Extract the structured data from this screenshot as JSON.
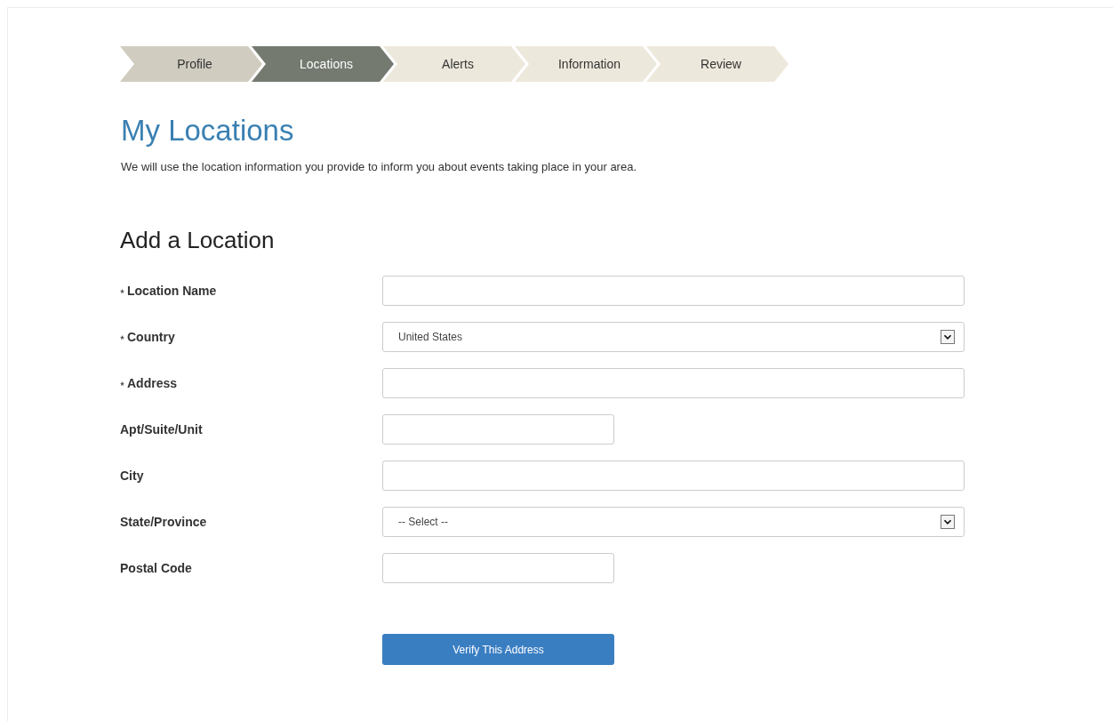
{
  "steps": [
    {
      "label": "Profile",
      "completed": true,
      "selected": false
    },
    {
      "label": "Locations",
      "completed": false,
      "selected": true
    },
    {
      "label": "Alerts",
      "completed": false,
      "selected": false
    },
    {
      "label": "Information",
      "completed": false,
      "selected": false
    },
    {
      "label": "Review",
      "completed": false,
      "selected": false
    }
  ],
  "title": "My Locations",
  "description": "We will use the location information you provide to inform you about events taking place in your area.",
  "form": {
    "title": "Add a Location",
    "fields": [
      {
        "label": "Location Name",
        "required": true,
        "kind": "text"
      },
      {
        "label": "Country",
        "required": true,
        "kind": "select",
        "value": "United States"
      },
      {
        "label": "Address",
        "required": true,
        "kind": "text"
      },
      {
        "label": "Apt/Suite/Unit",
        "required": false,
        "kind": "short-text"
      },
      {
        "label": "City",
        "required": false,
        "kind": "text"
      },
      {
        "label": "State/Province",
        "required": false,
        "kind": "select",
        "value": "-- Select --"
      },
      {
        "label": "Postal Code",
        "required": false,
        "kind": "short-text"
      }
    ],
    "button": "Verify This Address"
  }
}
